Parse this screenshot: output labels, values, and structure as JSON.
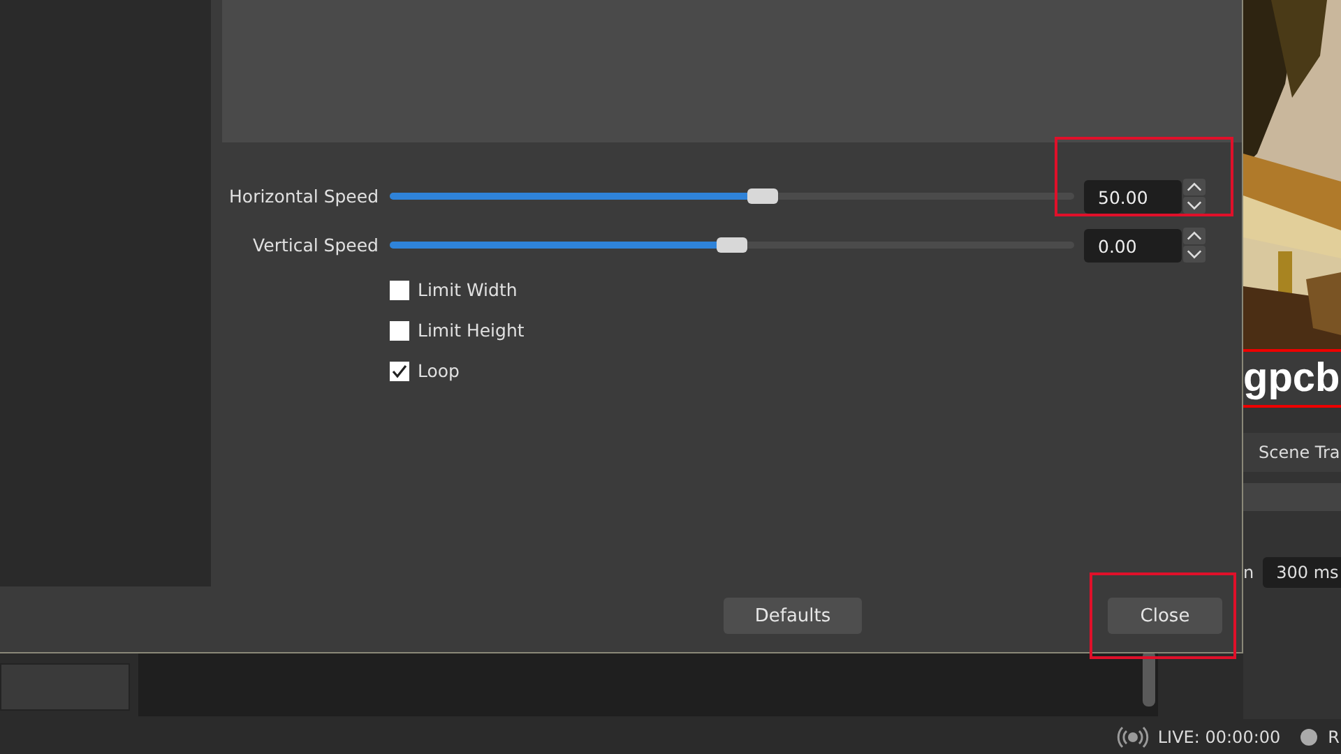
{
  "dialog": {
    "properties": [
      {
        "kind": "slider",
        "label": "Horizontal Speed",
        "level": 0.545,
        "value": "50.00",
        "highlighted": true
      },
      {
        "kind": "slider",
        "label": "Vertical Speed",
        "level": 0.5,
        "value": "0.00",
        "highlighted": false
      },
      {
        "kind": "checkbox",
        "label": "Limit Width",
        "checked": false
      },
      {
        "kind": "checkbox",
        "label": "Limit Height",
        "checked": false
      },
      {
        "kind": "checkbox",
        "label": "Loop",
        "checked": true
      }
    ],
    "buttons": [
      {
        "label": "Defaults",
        "highlighted": false
      },
      {
        "label": "Close",
        "highlighted": true
      }
    ]
  },
  "preview": {
    "overlay_text": "gpcb"
  },
  "transitions": {
    "tab": "Scene Tra",
    "duration_label": "n",
    "duration": "300 ms"
  },
  "status_bar": {
    "live": "LIVE: 00:00:00",
    "rec": "R"
  }
}
